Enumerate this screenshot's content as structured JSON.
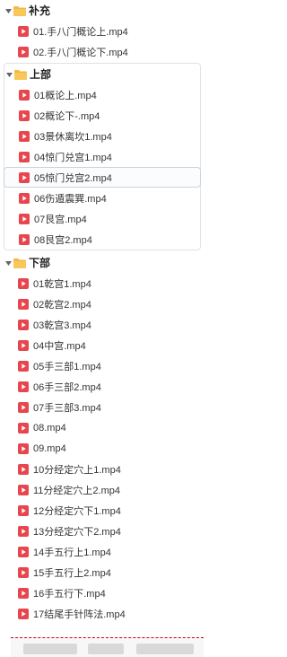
{
  "colors": {
    "folder": "#f5b840",
    "video": "#e8464e",
    "selected_border": "#c9d3de"
  },
  "icons": {
    "folder": "folder-icon",
    "video": "video-file-icon",
    "caret": "caret-down-icon"
  },
  "groups": [
    {
      "name": "补充",
      "files": [
        "01.手八门概论上.mp4",
        "02.手八门概论下.mp4"
      ]
    },
    {
      "name": "上部",
      "files": [
        "01概论上.mp4",
        "02概论下-.mp4",
        "03景休离坎1.mp4",
        "04惊门兑宫1.mp4",
        "05惊门兑宫2.mp4",
        "06伤遁震巽.mp4",
        "07艮宫.mp4",
        "08艮宫2.mp4"
      ],
      "selected_index": 4
    },
    {
      "name": "下部",
      "files": [
        "01乾宫1.mp4",
        "02乾宫2.mp4",
        "03乾宫3.mp4",
        "04中宫.mp4",
        "05手三部1.mp4",
        "06手三部2.mp4",
        "07手三部3.mp4",
        "08.mp4",
        "09.mp4",
        "10分经定穴上1.mp4",
        "11分经定穴上2.mp4",
        "12分经定穴下1.mp4",
        "13分经定穴下2.mp4",
        "14手五行上1.mp4",
        "15手五行上2.mp4",
        "16手五行下.mp4",
        "17结尾手针阵法.mp4"
      ]
    }
  ]
}
